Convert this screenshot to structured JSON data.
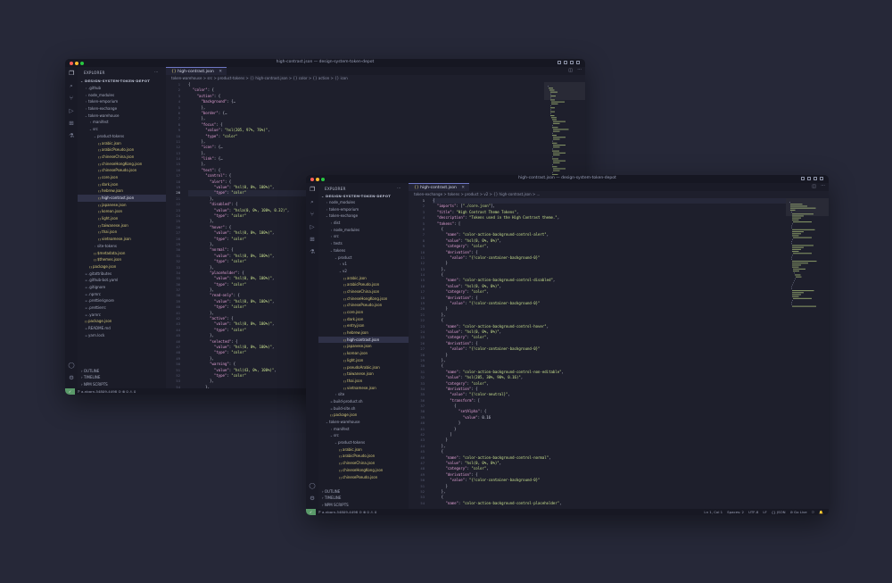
{
  "colors": {
    "desktop": "#262838",
    "close": "#ff5f57",
    "minimize": "#febc2e",
    "maximize": "#28c840",
    "json_icon": "#d3c77a",
    "accent": "#6e77c4"
  },
  "w1": {
    "title": "high-contrast.json — design-system-token-depot",
    "explorer_label": "EXPLORER",
    "root_label": "DESIGN-SYSTEM-TOKEN-DEPOT",
    "tree": [
      {
        "label": ".github",
        "indent": 1,
        "chev": ">"
      },
      {
        "label": "node_modules",
        "indent": 1,
        "chev": ">"
      },
      {
        "label": "token-emporium",
        "indent": 1,
        "chev": ">"
      },
      {
        "label": "token-exchange",
        "indent": 1,
        "chev": ">"
      },
      {
        "label": "token-warehouse",
        "indent": 1,
        "chev": "v"
      },
      {
        "label": "manifest",
        "indent": 2,
        "chev": ">"
      },
      {
        "label": "src",
        "indent": 2,
        "chev": "v"
      },
      {
        "label": "product-tokens",
        "indent": 3,
        "chev": "v"
      },
      {
        "label": "arabic.json",
        "indent": 4,
        "file": "json"
      },
      {
        "label": "arabicPseudo.json",
        "indent": 4,
        "file": "json"
      },
      {
        "label": "chineseChina.json",
        "indent": 4,
        "file": "json"
      },
      {
        "label": "chineseHongKong.json",
        "indent": 4,
        "file": "json"
      },
      {
        "label": "chinesePseudo.json",
        "indent": 4,
        "file": "json"
      },
      {
        "label": "core.json",
        "indent": 4,
        "file": "json"
      },
      {
        "label": "dark.json",
        "indent": 4,
        "file": "json"
      },
      {
        "label": "hebrew.json",
        "indent": 4,
        "file": "json"
      },
      {
        "label": "high-contrast.json",
        "indent": 4,
        "file": "json",
        "selected": true
      },
      {
        "label": "japanese.json",
        "indent": 4,
        "file": "json"
      },
      {
        "label": "korean.json",
        "indent": 4,
        "file": "json"
      },
      {
        "label": "light.json",
        "indent": 4,
        "file": "json"
      },
      {
        "label": "taiwanese.json",
        "indent": 4,
        "file": "json"
      },
      {
        "label": "thai.json",
        "indent": 4,
        "file": "json"
      },
      {
        "label": "vietnamese.json",
        "indent": 4,
        "file": "json"
      },
      {
        "label": "site-tokens",
        "indent": 3,
        "chev": ">"
      },
      {
        "label": "$metadata.json",
        "indent": 3,
        "file": "json"
      },
      {
        "label": "$themes.json",
        "indent": 3,
        "file": "json"
      },
      {
        "label": "package.json",
        "indent": 2,
        "file": "json"
      },
      {
        "label": ".gitattributes",
        "indent": 1,
        "file": "misc"
      },
      {
        "label": ".github-bot.yaml",
        "indent": 1,
        "file": "misc"
      },
      {
        "label": ".gitignore",
        "indent": 1,
        "file": "misc"
      },
      {
        "label": ".npmrc",
        "indent": 1,
        "file": "misc"
      },
      {
        "label": ".prettierignore",
        "indent": 1,
        "file": "misc"
      },
      {
        "label": ".prettierrc",
        "indent": 1,
        "file": "misc"
      },
      {
        "label": ".yarnrc",
        "indent": 1,
        "file": "misc"
      },
      {
        "label": "package.json",
        "indent": 1,
        "file": "json"
      },
      {
        "label": "README.md",
        "indent": 1,
        "file": "misc"
      },
      {
        "label": "yarn.lock",
        "indent": 1,
        "file": "misc"
      }
    ],
    "outline": "OUTLINE",
    "timeline": "TIMELINE",
    "npm_scripts": "NPM SCRIPTS",
    "tab": "high-contrast.json",
    "breadcrumb": "token-warehouse > src > product-tokens > {} high-contrast.json > {} color > {} action > {} icon",
    "status_branch": "ℙ a-nbarn-54809-4498 ⊙ ⊗ 0 ⚠ 0",
    "line_start": 1,
    "active_line": 20,
    "code": [
      "{",
      "  \"color\": {",
      "    \"action\": {",
      "      \"background\": {…",
      "      },",
      "      \"border\": {…",
      "      },",
      "      \"focus\": {",
      "        \"value\": \"hsl(205, 97%, 76%)\",",
      "        \"type\": \"color\"",
      "      },",
      "      \"icon\": {…",
      "      },",
      "      \"link\": {…",
      "      },",
      "      \"text\": {",
      "        \"control\": {",
      "          \"alert\": {",
      "            \"value\": \"hsl(0, 0%, 100%)\",",
      "            \"type\": \"color\"",
      "          },",
      "          \"disabled\": {",
      "            \"value\": \"hsla(0, 0%, 100%, 0.32)\",",
      "            \"type\": \"color\"",
      "          },",
      "          \"hover\": {",
      "            \"value\": \"hsl(0, 0%, 100%)\",",
      "            \"type\": \"color\"",
      "          },",
      "          \"normal\": {",
      "            \"value\": \"hsl(0, 0%, 100%)\",",
      "            \"type\": \"color\"",
      "          },",
      "          \"placeholder\": {",
      "            \"value\": \"hsl(0, 0%, 100%)\",",
      "            \"type\": \"color\"",
      "          },",
      "          \"read-only\": {",
      "            \"value\": \"hsl(0, 0%, 100%)\",",
      "            \"type\": \"color\"",
      "          },",
      "          \"active\": {",
      "            \"value\": \"hsl(0, 0%, 100%)\",",
      "            \"type\": \"color\"",
      "          },",
      "          \"selected\": {",
      "            \"value\": \"hsl(0, 0%, 100%)\",",
      "            \"type\": \"color\"",
      "          },",
      "          \"warning\": {",
      "            \"value\": \"hsl(43, 0%, 100%)\",",
      "            \"type\": \"color\"",
      "          },",
      "        },"
    ]
  },
  "w2": {
    "title": "high-contrast.json — design-system-token-depot",
    "explorer_label": "EXPLORER",
    "root_label": "DESIGN-SYSTEM-TOKEN-DEPOT",
    "tree": [
      {
        "label": "node_modules",
        "indent": 1,
        "chev": ">"
      },
      {
        "label": "token-emporium",
        "indent": 1,
        "chev": ">"
      },
      {
        "label": "token-exchange",
        "indent": 1,
        "chev": "v"
      },
      {
        "label": "dist",
        "indent": 2,
        "chev": ">"
      },
      {
        "label": "node_modules",
        "indent": 2,
        "chev": ">"
      },
      {
        "label": "src",
        "indent": 2,
        "chev": ">"
      },
      {
        "label": "tests",
        "indent": 2,
        "chev": ">"
      },
      {
        "label": "tokens",
        "indent": 2,
        "chev": "v"
      },
      {
        "label": "product",
        "indent": 3,
        "chev": "v"
      },
      {
        "label": "v1",
        "indent": 4,
        "chev": ">"
      },
      {
        "label": "v2",
        "indent": 4,
        "chev": "v"
      },
      {
        "label": "arabic.json",
        "indent": 5,
        "file": "json"
      },
      {
        "label": "arabicPseudo.json",
        "indent": 5,
        "file": "json"
      },
      {
        "label": "chineseChina.json",
        "indent": 5,
        "file": "json"
      },
      {
        "label": "chineseHongKong.json",
        "indent": 5,
        "file": "json"
      },
      {
        "label": "chinesePseudo.json",
        "indent": 5,
        "file": "json"
      },
      {
        "label": "core.json",
        "indent": 5,
        "file": "json"
      },
      {
        "label": "dark.json",
        "indent": 5,
        "file": "json"
      },
      {
        "label": "entry.json",
        "indent": 5,
        "file": "json"
      },
      {
        "label": "hebrew.json",
        "indent": 5,
        "file": "json"
      },
      {
        "label": "high-contrast.json",
        "indent": 5,
        "file": "json",
        "selected": true
      },
      {
        "label": "japanese.json",
        "indent": 5,
        "file": "json"
      },
      {
        "label": "korean.json",
        "indent": 5,
        "file": "json"
      },
      {
        "label": "light.json",
        "indent": 5,
        "file": "json"
      },
      {
        "label": "pseudoArabic.json",
        "indent": 5,
        "file": "json"
      },
      {
        "label": "taiwanese.json",
        "indent": 5,
        "file": "json"
      },
      {
        "label": "thai.json",
        "indent": 5,
        "file": "json"
      },
      {
        "label": "vietnamese.json",
        "indent": 5,
        "file": "json"
      },
      {
        "label": "site",
        "indent": 3,
        "chev": ">"
      },
      {
        "label": "build-product.sh",
        "indent": 2,
        "file": "misc"
      },
      {
        "label": "build-site.sh",
        "indent": 2,
        "file": "misc"
      },
      {
        "label": "package.json",
        "indent": 2,
        "file": "json"
      },
      {
        "label": "token-warehouse",
        "indent": 1,
        "chev": "v"
      },
      {
        "label": "manifest",
        "indent": 2,
        "chev": ">"
      },
      {
        "label": "src",
        "indent": 2,
        "chev": "v"
      },
      {
        "label": "product-tokens",
        "indent": 3,
        "chev": "v"
      },
      {
        "label": "arabic.json",
        "indent": 4,
        "file": "json"
      },
      {
        "label": "arabicPseudo.json",
        "indent": 4,
        "file": "json"
      },
      {
        "label": "chineseChina.json",
        "indent": 4,
        "file": "json"
      },
      {
        "label": "chineseHongKong.json",
        "indent": 4,
        "file": "json"
      },
      {
        "label": "chinesePseudo.json",
        "indent": 4,
        "file": "json"
      }
    ],
    "outline": "OUTLINE",
    "timeline": "TIMELINE",
    "npm_scripts": "NPM SCRIPTS",
    "tab": "high-contrast.json",
    "breadcrumb": "token-exchange > tokens > product > v2 > {} high-contrast.json > ...",
    "status_branch": "ℙ a-nbarn-54809-4498 ⊙ ⊗ 0 ⚠ 0",
    "status_right": [
      "Ln 1, Col 1",
      "Spaces: 2",
      "UTF-8",
      "LF",
      "{} JSON",
      "⊘ Go Live",
      "⚆",
      "🔔"
    ],
    "line_start": 1,
    "active_line": 1,
    "code": [
      "{",
      "  \"imports\": [\"./core.json\"],",
      "  \"title\": \"High Contrast Theme Tokens\",",
      "  \"description\": \"Tokens used in the High Contrast theme.\",",
      "  \"tokens\": [",
      "    {",
      "      \"name\": \"color-action-background-control-alert\",",
      "      \"value\": \"hsl(0, 0%, 0%)\",",
      "      \"category\": \"color\",",
      "      \"derivation\": {",
      "        \"value\": \"{!color-container-background-0}\"",
      "      }",
      "    },",
      "    {",
      "      \"name\": \"color-action-background-control-disabled\",",
      "      \"value\": \"hsl(0, 0%, 0%)\",",
      "      \"category\": \"color\",",
      "      \"derivation\": {",
      "        \"value\": \"{!color-container-background-0}\"",
      "      }",
      "    },",
      "    {",
      "      \"name\": \"color-action-background-control-hover\",",
      "      \"value\": \"hsl(0, 0%, 0%)\",",
      "      \"category\": \"color\",",
      "      \"derivation\": {",
      "        \"value\": \"{!color-container-background-0}\"",
      "      }",
      "    },",
      "    {",
      "      \"name\": \"color-action-background-control-non-editable\",",
      "      \"value\": \"hsl(205, 30%, 90%, 0.16)\",",
      "      \"category\": \"color\",",
      "      \"derivation\": {",
      "        \"value\": \"{!color-neutral}\",",
      "        \"transform\": [",
      "          {",
      "            \"setAlpha\": {",
      "              \"value\": 0.16",
      "            }",
      "          }",
      "        ]",
      "      }",
      "    },",
      "    {",
      "      \"name\": \"color-action-background-control-normal\",",
      "      \"value\": \"hsl(0, 0%, 0%)\",",
      "      \"category\": \"color\",",
      "      \"derivation\": {",
      "        \"value\": \"{!color-container-background-0}\"",
      "      }",
      "    },",
      "    {",
      "      \"name\": \"color-action-background-control-placeholder\","
    ]
  }
}
